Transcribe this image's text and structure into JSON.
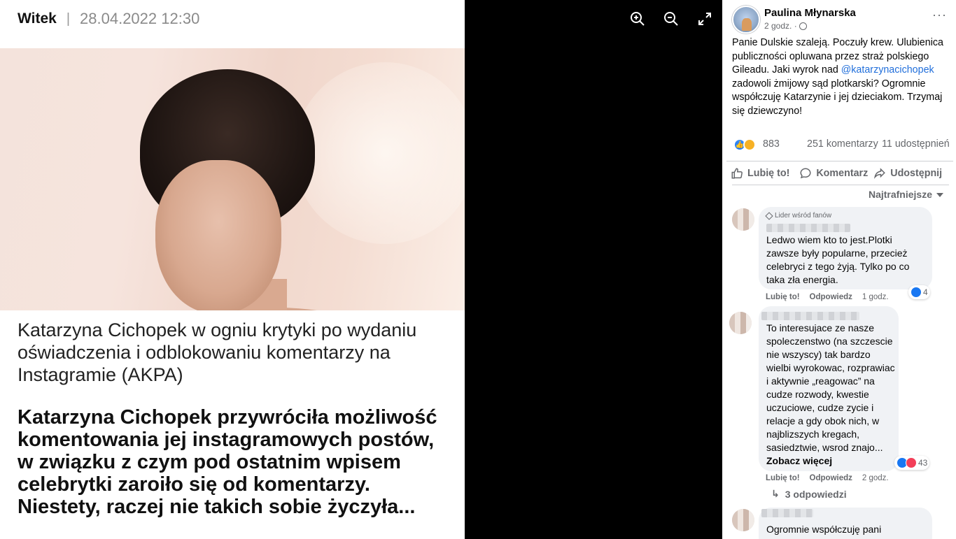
{
  "article": {
    "author": "Witek",
    "separator": "|",
    "datetime": "28.04.2022 12:30",
    "title": "Katarzyna Cichopek w ogniu krytyki po wydaniu oświadczenia i odblokowaniu komentarzy na Instagramie (AKPA)",
    "lead": "Katarzyna Cichopek przywróciła możliwość komentowania jej instagramowych postów, w związku z czym pod ostatnim wpisem celebrytki zaroiło się od komentarzy. Niestety, raczej nie takich sobie życzyła..."
  },
  "viewer_tools": [
    "zoom-in-icon",
    "zoom-out-icon",
    "fullscreen-icon"
  ],
  "post": {
    "author": "Paulina Młynarska",
    "time": "2 godz. ·",
    "text_before": "Panie Dulskie szaleją. Poczuły krew. Ulubienica publiczności opluwana przez straż polskiego Gileadu. Jaki wyrok nad ",
    "mention": "@katarzynacichopek",
    "text_after": " zadowoli żmijowy sąd plotkarski? Ogromnie współczuję Katarzynie i jej dzieciakom. Trzymaj się dziewczyno!",
    "reactions_count": "883",
    "comments_count": "251 komentarzy",
    "shares_count": "11 udostępnień",
    "like_label": "Lubię to!",
    "comment_label": "Komentarz",
    "share_label": "Udostępnij",
    "sort_label": "Najtrafniejsze"
  },
  "comments": [
    {
      "badge": "Lider wśród fanów",
      "text": "Ledwo wiem kto to jest.Plotki zawsze były popularne, przecież celebryci z tego żyją. Tylko po co taka zła energia.",
      "reactions": "4",
      "like": "Lubię to!",
      "reply": "Odpowiedz",
      "time": "1 godz."
    },
    {
      "text": "To interesujace ze nasze spoleczenstwo (na szczescie nie wszyscy) tak bardzo wielbi wyrokowac, rozprawiac i aktywnie „reagowac” na cudze rozwody, kwestie uczuciowe, cudze zycie i relacje a gdy obok nich, w najblizszych kregach, sasiedztwie, wsrod znajo...",
      "see_more": "Zobacz więcej",
      "reactions": "43",
      "like": "Lubię to!",
      "reply": "Odpowiedz",
      "time": "2 godz.",
      "replies": "3 odpowiedzi"
    },
    {
      "text": "Ogromnie współczuję pani"
    }
  ]
}
